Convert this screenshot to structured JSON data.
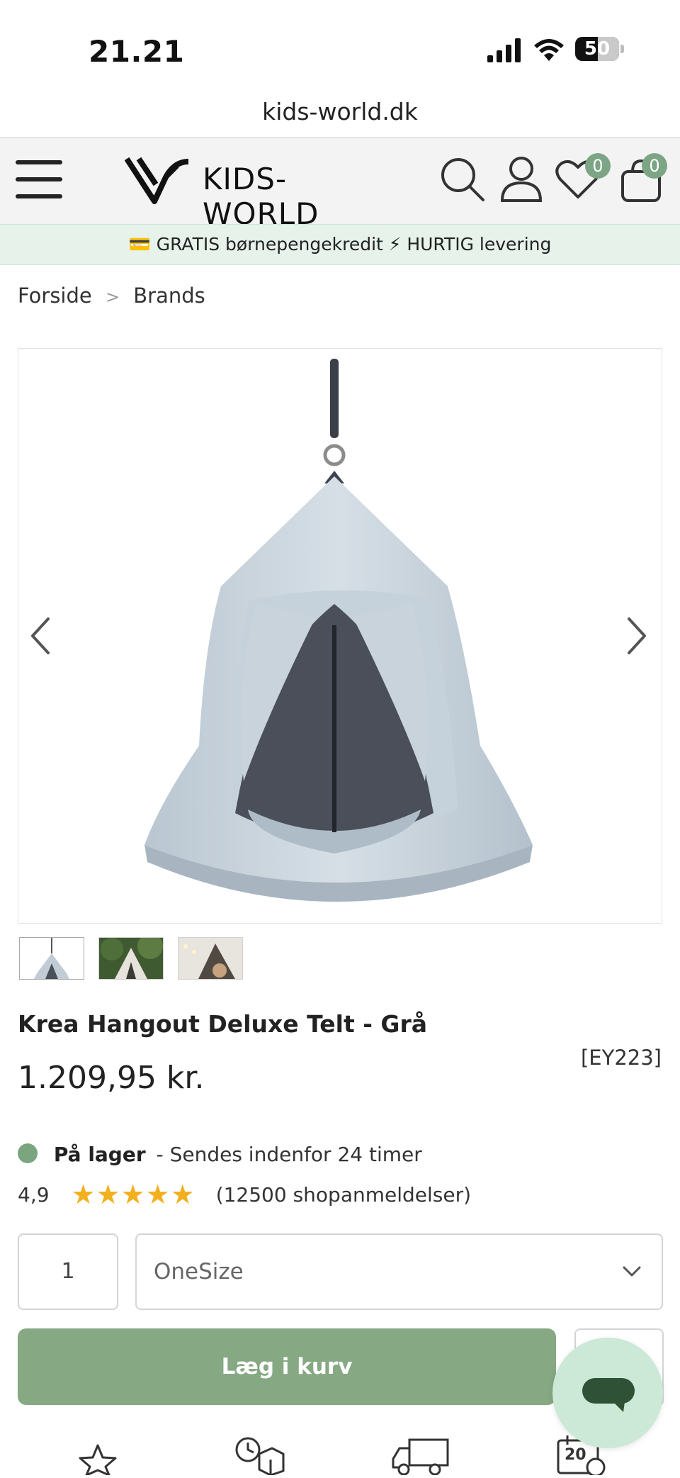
{
  "status_bar": {
    "time": "21.21",
    "battery": "50"
  },
  "browser": {
    "url": "kids-world.dk"
  },
  "header": {
    "brand": "KIDS-WORLD",
    "wishlist_count": "0",
    "cart_count": "0",
    "icons": [
      "menu-icon",
      "search-icon",
      "user-icon",
      "heart-icon",
      "bag-icon"
    ]
  },
  "promo": {
    "icon1": "💳",
    "text1": "GRATIS børnepengekredit",
    "icon2": "⚡",
    "text2": "HURTIG levering"
  },
  "breadcrumb": {
    "home": "Forside",
    "separator": ">",
    "current": "Brands"
  },
  "product": {
    "title": "Krea Hangout Deluxe Telt - Grå",
    "sku": "[EY223]",
    "price": "1.209,95 kr.",
    "stock_label": "På lager",
    "stock_detail": "- Sendes indenfor 24 timer",
    "rating": "4,9",
    "stars": 5,
    "reviews": "(12500 shopanmeldelser)",
    "quantity": "1",
    "size_selected": "OneSize",
    "add_to_cart": "Læg i kurv"
  },
  "footer_icons": {
    "calendar_number": "20"
  },
  "colors": {
    "accent": "#86a883",
    "badge": "#7ca585",
    "promo_bg": "#e6f2ea",
    "star": "#f2b01e",
    "stock_dot": "#7aa57e",
    "chat_bg": "#cbe9d6",
    "chat_icon": "#2f5236"
  }
}
